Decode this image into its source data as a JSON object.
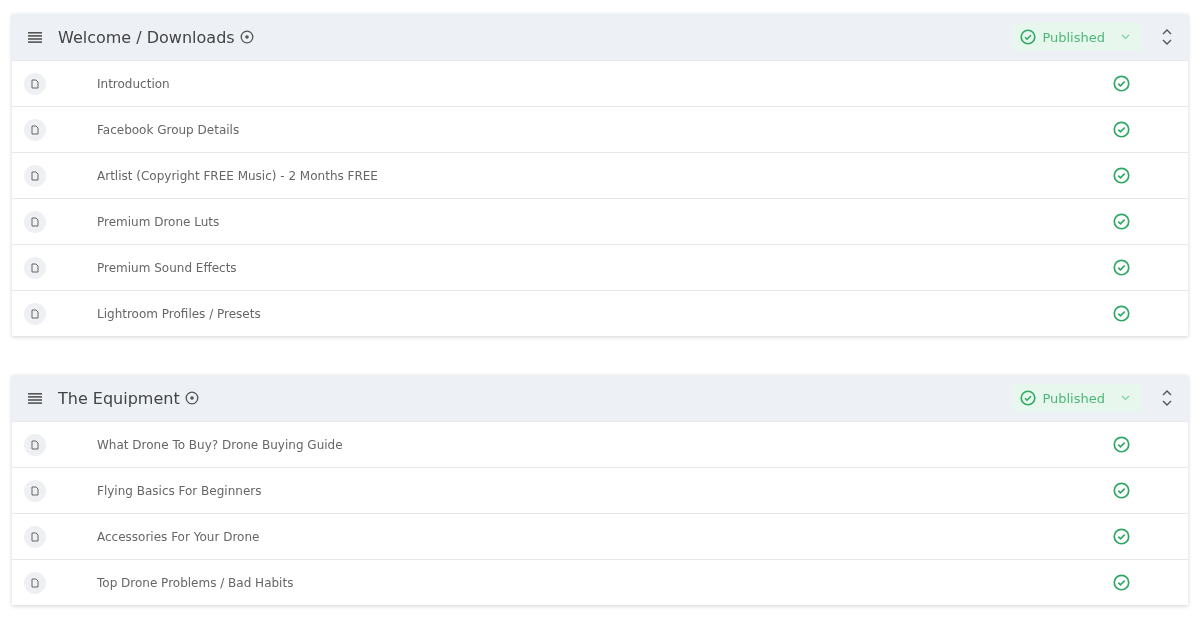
{
  "sections": [
    {
      "title": "Welcome / Downloads",
      "status": "Published",
      "lessons": [
        {
          "title": "Introduction",
          "published": true
        },
        {
          "title": "Facebook Group Details",
          "published": true
        },
        {
          "title": "Artlist (Copyright FREE Music) - 2 Months FREE",
          "published": true
        },
        {
          "title": "Premium Drone Luts",
          "published": true
        },
        {
          "title": "Premium Sound Effects",
          "published": true
        },
        {
          "title": "Lightroom Profiles / Presets",
          "published": true
        }
      ]
    },
    {
      "title": "The Equipment",
      "status": "Published",
      "lessons": [
        {
          "title": "What Drone To Buy? Drone Buying Guide",
          "published": true
        },
        {
          "title": "Flying Basics For Beginners",
          "published": true
        },
        {
          "title": "Accessories For Your Drone",
          "published": true
        },
        {
          "title": "Top Drone Problems / Bad Habits",
          "published": true
        }
      ]
    }
  ]
}
